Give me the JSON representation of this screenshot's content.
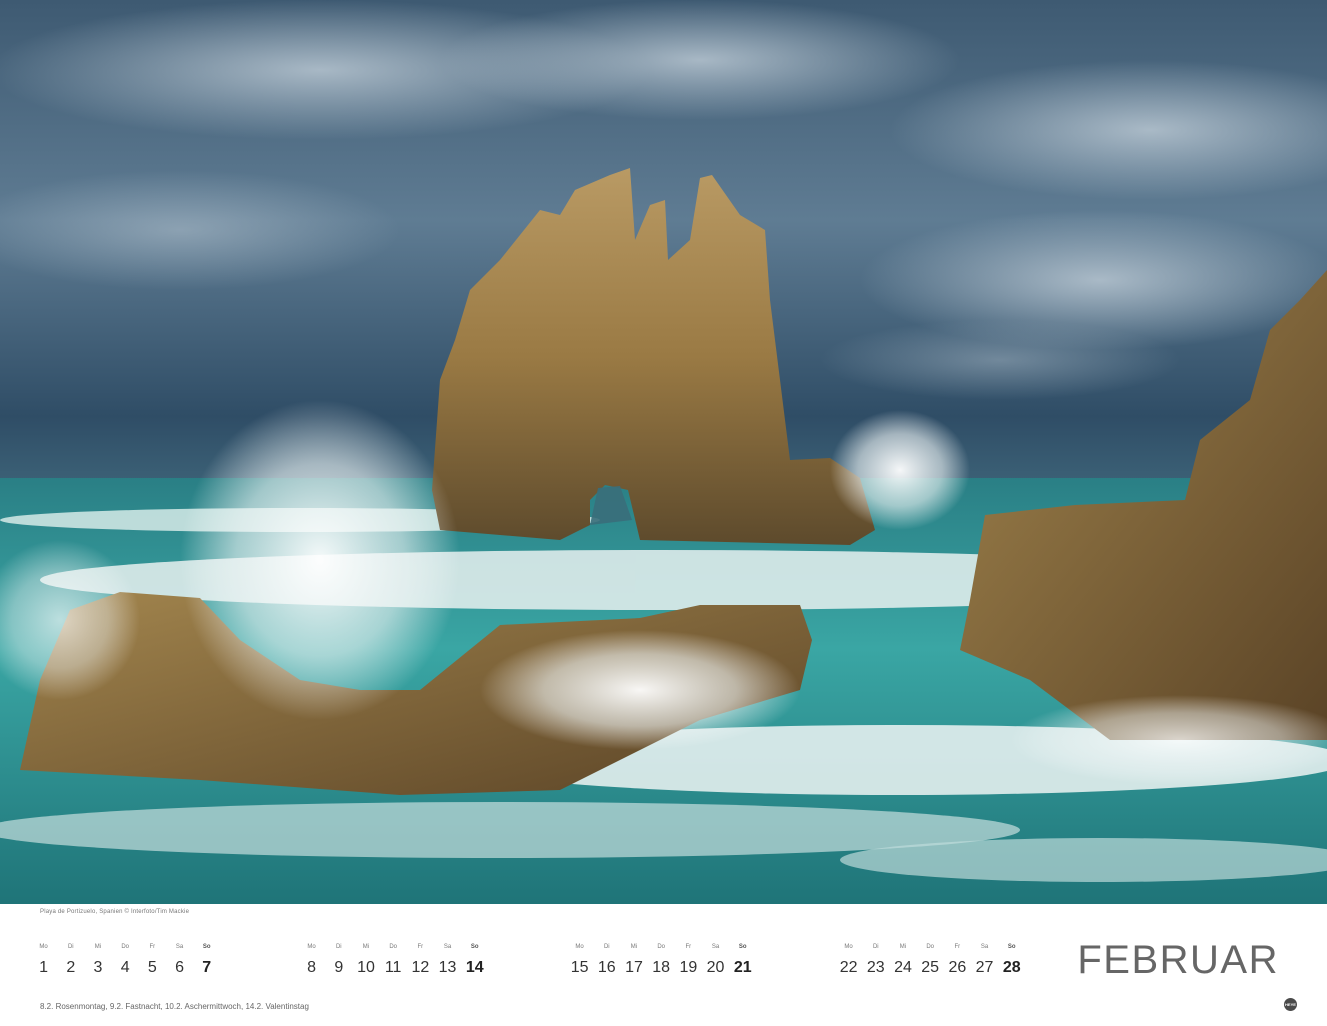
{
  "photo": {
    "caption": "Playa de Portizuelo, Spanien © Interfoto/Tim Mackie"
  },
  "calendar": {
    "month": "FEBRUAR",
    "weeks": [
      {
        "days": [
          {
            "name": "Mo",
            "date": "1",
            "sunday": false
          },
          {
            "name": "Di",
            "date": "2",
            "sunday": false
          },
          {
            "name": "Mi",
            "date": "3",
            "sunday": false
          },
          {
            "name": "Do",
            "date": "4",
            "sunday": false
          },
          {
            "name": "Fr",
            "date": "5",
            "sunday": false
          },
          {
            "name": "Sa",
            "date": "6",
            "sunday": false
          },
          {
            "name": "So",
            "date": "7",
            "sunday": true
          }
        ]
      },
      {
        "days": [
          {
            "name": "Mo",
            "date": "8",
            "sunday": false
          },
          {
            "name": "Di",
            "date": "9",
            "sunday": false
          },
          {
            "name": "Mi",
            "date": "10",
            "sunday": false
          },
          {
            "name": "Do",
            "date": "11",
            "sunday": false
          },
          {
            "name": "Fr",
            "date": "12",
            "sunday": false
          },
          {
            "name": "Sa",
            "date": "13",
            "sunday": false
          },
          {
            "name": "So",
            "date": "14",
            "sunday": true
          }
        ]
      },
      {
        "days": [
          {
            "name": "Mo",
            "date": "15",
            "sunday": false
          },
          {
            "name": "Di",
            "date": "16",
            "sunday": false
          },
          {
            "name": "Mi",
            "date": "17",
            "sunday": false
          },
          {
            "name": "Do",
            "date": "18",
            "sunday": false
          },
          {
            "name": "Fr",
            "date": "19",
            "sunday": false
          },
          {
            "name": "Sa",
            "date": "20",
            "sunday": false
          },
          {
            "name": "So",
            "date": "21",
            "sunday": true
          }
        ]
      },
      {
        "days": [
          {
            "name": "Mo",
            "date": "22",
            "sunday": false
          },
          {
            "name": "Di",
            "date": "23",
            "sunday": false
          },
          {
            "name": "Mi",
            "date": "24",
            "sunday": false
          },
          {
            "name": "Do",
            "date": "25",
            "sunday": false
          },
          {
            "name": "Fr",
            "date": "26",
            "sunday": false
          },
          {
            "name": "Sa",
            "date": "27",
            "sunday": false
          },
          {
            "name": "So",
            "date": "28",
            "sunday": true
          }
        ]
      }
    ],
    "holidays": "8.2. Rosenmontag, 9.2. Fastnacht, 10.2. Aschermittwoch, 14.2. Valentinstag"
  },
  "publisher": {
    "logo_text": "HEYE"
  }
}
